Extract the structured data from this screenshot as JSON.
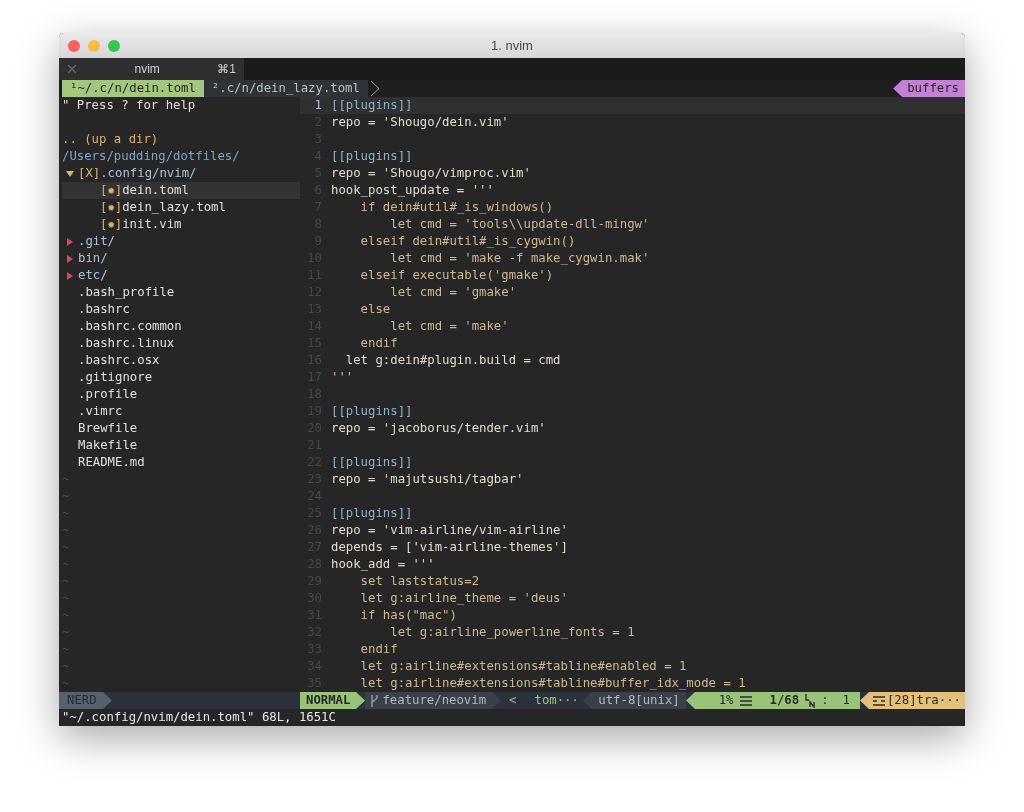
{
  "window": {
    "title": "1. nvim"
  },
  "terminal_tabs": [
    {
      "label": "nvim",
      "shortcut": "⌘1",
      "selected": true
    }
  ],
  "buffer_tabs": [
    {
      "label": "¹~/.c/n/dein.toml",
      "selected": true
    },
    {
      "label": "².c/n/dein_lazy.toml",
      "selected": false
    }
  ],
  "buffers_label": "buffers",
  "tree": {
    "help": "\" Press ? for help",
    "updir": ".. (up a dir)",
    "root": "/Users/pudding/dotfiles/",
    "items": [
      {
        "name": ".config/nvim/",
        "kind": "dir",
        "expanded": true,
        "marker": "[X]",
        "selected": false,
        "children": [
          {
            "name": "dein.toml",
            "kind": "file",
            "marker": "[✹]",
            "selected": true
          },
          {
            "name": "dein_lazy.toml",
            "kind": "file",
            "marker": "[✹]",
            "selected": false
          },
          {
            "name": "init.vim",
            "kind": "file",
            "marker": "[✹]",
            "selected": false
          }
        ]
      },
      {
        "name": ".git/",
        "kind": "dir",
        "expanded": false,
        "selected": false
      },
      {
        "name": "bin/",
        "kind": "dir",
        "expanded": false,
        "selected": false
      },
      {
        "name": "etc/",
        "kind": "dir",
        "expanded": false,
        "selected": false
      },
      {
        "name": ".bash_profile",
        "kind": "file",
        "selected": false
      },
      {
        "name": ".bashrc",
        "kind": "file",
        "selected": false
      },
      {
        "name": ".bashrc.common",
        "kind": "file",
        "selected": false
      },
      {
        "name": ".bashrc.linux",
        "kind": "file",
        "selected": false
      },
      {
        "name": ".bashrc.osx",
        "kind": "file",
        "selected": false
      },
      {
        "name": ".gitignore",
        "kind": "file",
        "selected": false
      },
      {
        "name": ".profile",
        "kind": "file",
        "selected": false
      },
      {
        "name": ".vimrc",
        "kind": "file",
        "selected": false
      },
      {
        "name": "Brewfile",
        "kind": "file",
        "selected": false
      },
      {
        "name": "Makefile",
        "kind": "file",
        "selected": false
      },
      {
        "name": "README.md",
        "kind": "file",
        "selected": false
      }
    ],
    "end_of_buffer": [
      "~",
      "~",
      "~",
      "~",
      "~",
      "~",
      "~",
      "~",
      "~",
      "~",
      "~",
      "~",
      "~"
    ]
  },
  "code_lines": [
    {
      "num": "1",
      "text": "[[plugins]]",
      "kind": "section",
      "current": true
    },
    {
      "num": "2",
      "text": "repo = 'Shougo/dein.vim'",
      "kind": "plain",
      "current": false
    },
    {
      "num": "3",
      "current": false
    },
    {
      "num": "4",
      "text": "[[plugins]]",
      "kind": "section",
      "current": false
    },
    {
      "num": "5",
      "text": "repo = 'Shougo/vimproc.vim'",
      "kind": "plain",
      "current": false
    },
    {
      "num": "6",
      "text": "hook_post_update = '''",
      "kind": "plain",
      "current": false
    },
    {
      "num": "7",
      "text": "    if dein#util#_is_windows()",
      "kind": "script",
      "current": false
    },
    {
      "num": "8",
      "text": "        let cmd = 'tools\\\\update-dll-mingw'",
      "kind": "script",
      "current": false
    },
    {
      "num": "9",
      "text": "    elseif dein#util#_is_cygwin()",
      "kind": "script",
      "current": false
    },
    {
      "num": "10",
      "text": "        let cmd = 'make -f make_cygwin.mak'",
      "kind": "script",
      "current": false
    },
    {
      "num": "11",
      "text": "    elseif executable('gmake')",
      "kind": "script",
      "current": false
    },
    {
      "num": "12",
      "text": "        let cmd = 'gmake'",
      "kind": "script",
      "current": false
    },
    {
      "num": "13",
      "text": "    else",
      "kind": "script",
      "current": false
    },
    {
      "num": "14",
      "text": "        let cmd = 'make'",
      "kind": "script",
      "current": false
    },
    {
      "num": "15",
      "text": "    endif",
      "kind": "script",
      "current": false
    },
    {
      "num": "16",
      "text": "  let g:dein#plugin.build = cmd",
      "kind": "plain",
      "current": false
    },
    {
      "num": "17",
      "text": "'''",
      "kind": "script",
      "current": false
    },
    {
      "num": "18",
      "current": false
    },
    {
      "num": "19",
      "text": "[[plugins]]",
      "kind": "section",
      "current": false
    },
    {
      "num": "20",
      "text": "repo = 'jacoborus/tender.vim'",
      "kind": "plain",
      "current": false
    },
    {
      "num": "21",
      "current": false
    },
    {
      "num": "22",
      "text": "[[plugins]]",
      "kind": "section",
      "current": false
    },
    {
      "num": "23",
      "text": "repo = 'majutsushi/tagbar'",
      "kind": "plain",
      "current": false
    },
    {
      "num": "24",
      "current": false
    },
    {
      "num": "25",
      "text": "[[plugins]]",
      "kind": "section",
      "current": false
    },
    {
      "num": "26",
      "text": "repo = 'vim-airline/vim-airline'",
      "kind": "plain",
      "current": false
    },
    {
      "num": "27",
      "text": "depends = ['vim-airline-themes']",
      "kind": "plain",
      "current": false
    },
    {
      "num": "28",
      "text": "hook_add = '''",
      "kind": "plain",
      "current": false
    },
    {
      "num": "29",
      "text": "    set laststatus=2",
      "kind": "script",
      "current": false
    },
    {
      "num": "30",
      "text": "    let g:airline_theme = 'deus'",
      "kind": "script",
      "current": false
    },
    {
      "num": "31",
      "text": "    if has(\"mac\")",
      "kind": "script",
      "current": false
    },
    {
      "num": "32",
      "text": "        let g:airline_powerline_fonts = 1",
      "kind": "script",
      "current": false
    },
    {
      "num": "33",
      "text": "    endif",
      "kind": "script",
      "current": false
    },
    {
      "num": "34",
      "text": "    let g:airline#extensions#tabline#enabled = 1",
      "kind": "script",
      "current": false
    },
    {
      "num": "35",
      "text": "    let g:airline#extensions#tabline#buffer_idx_mode = 1",
      "kind": "script",
      "current": false
    }
  ],
  "status_line": {
    "tree_mode": "NERD",
    "mode": "NORMAL",
    "branch": "feature/neovim",
    "separator": "<",
    "file_type": "tom···",
    "encoding": "utf-8[unix]",
    "percent": "1%",
    "position": "1/68",
    "column_separator": ":",
    "column": "1",
    "warning": "[28]tra···"
  },
  "command_line": "\"~/.config/nvim/dein.toml\" 68L, 1651C"
}
